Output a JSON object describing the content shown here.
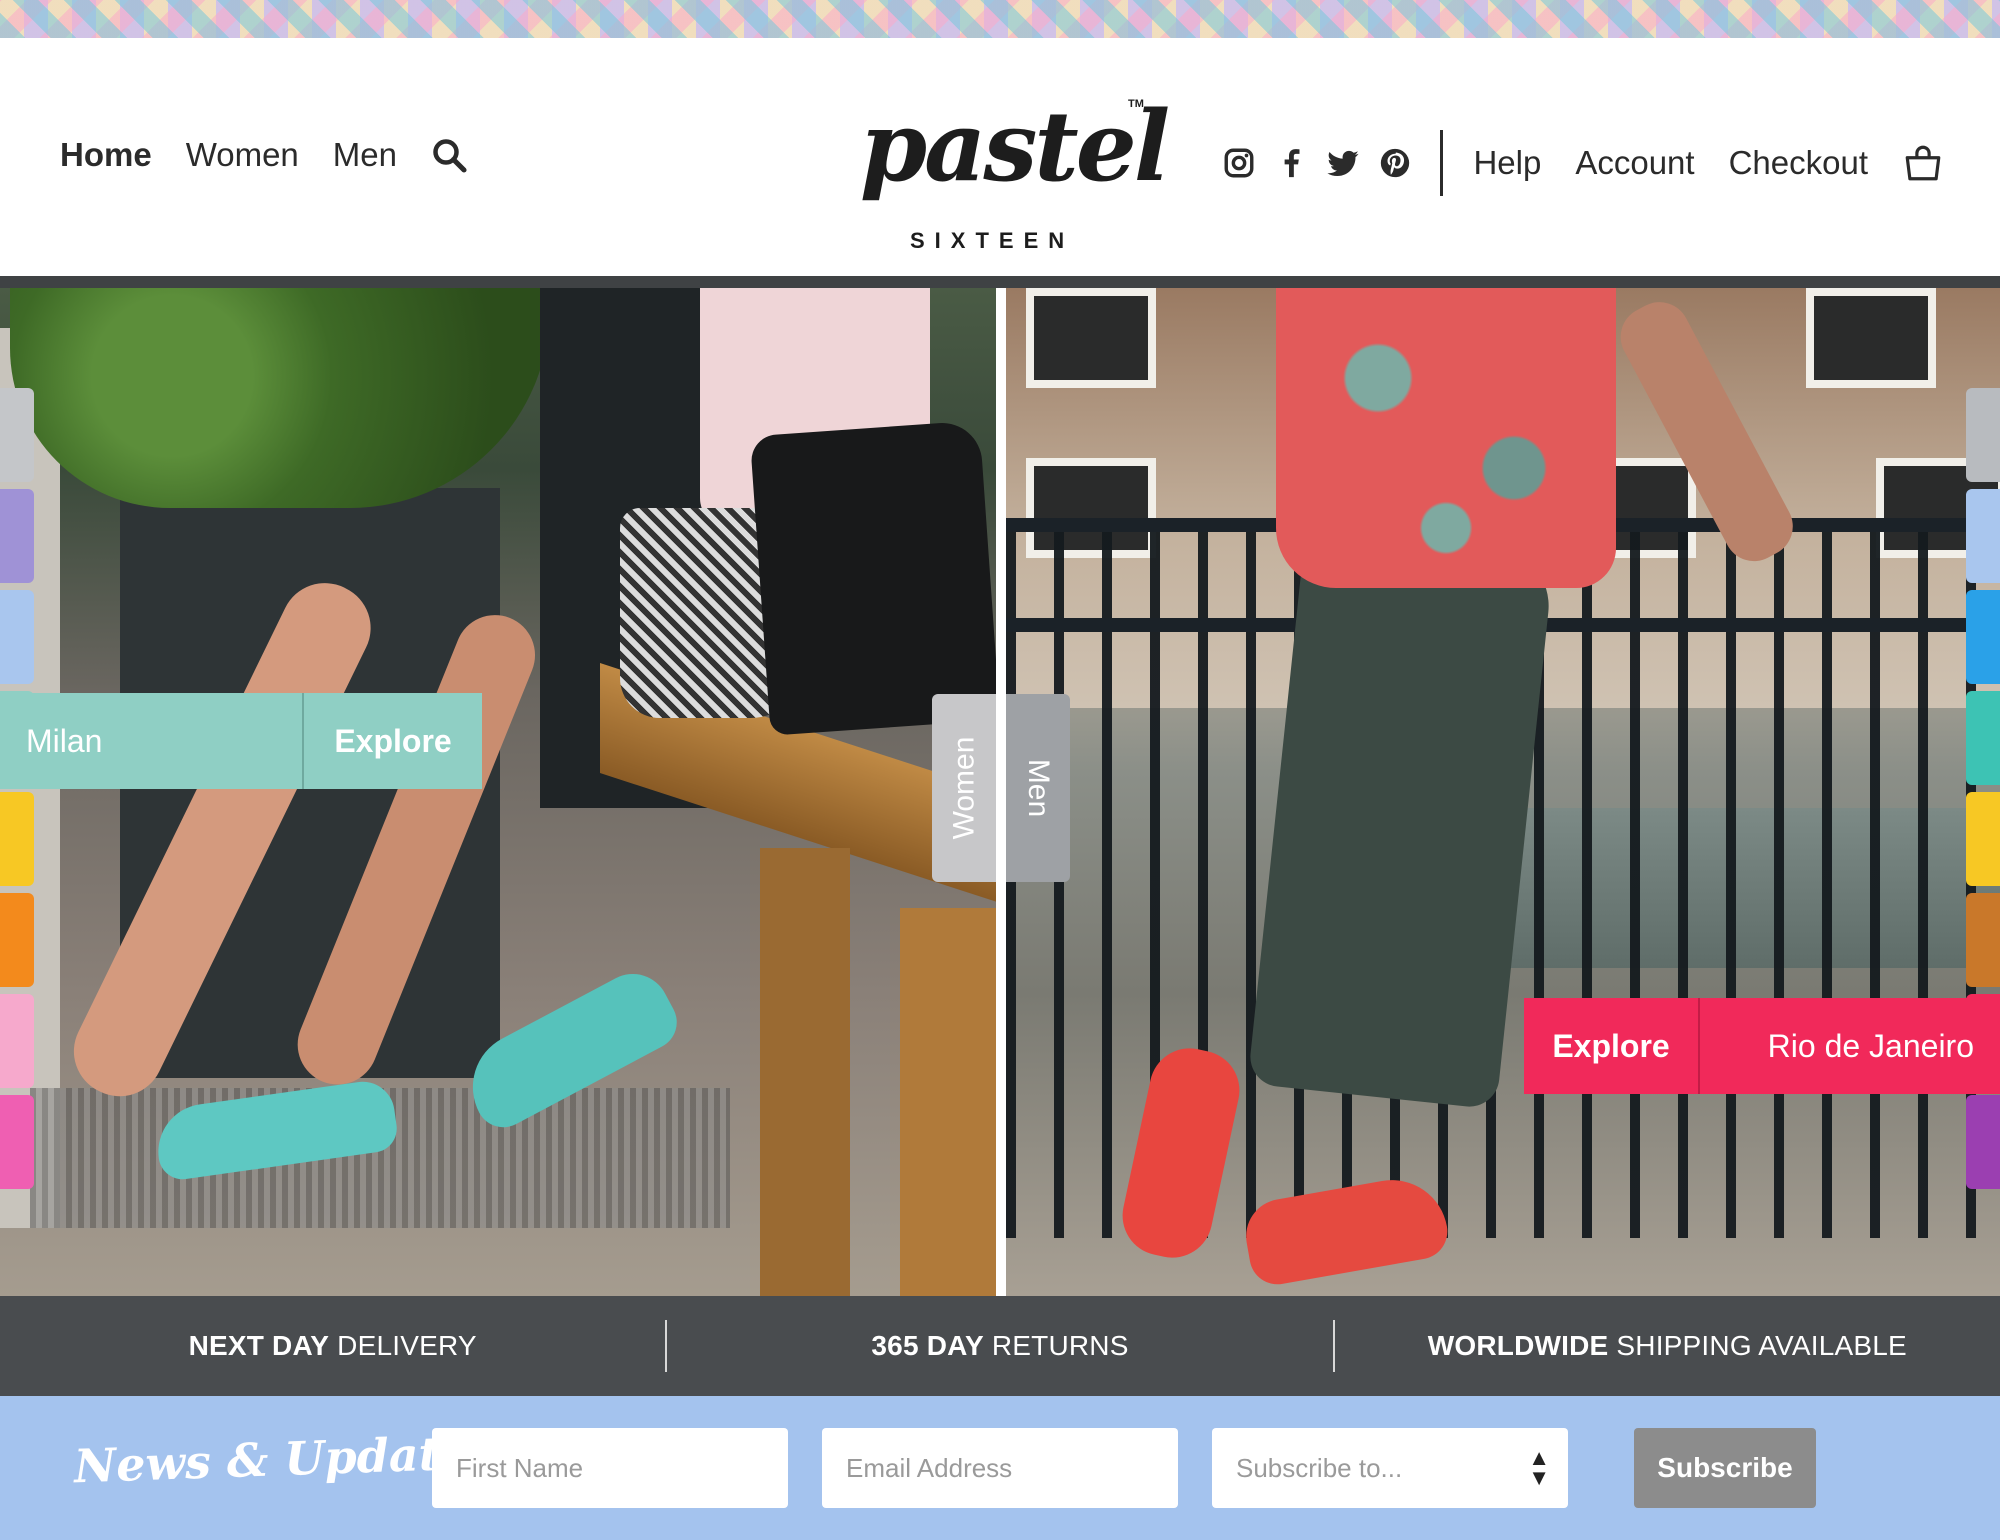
{
  "header": {
    "nav_left": [
      {
        "label": "Home",
        "active": true
      },
      {
        "label": "Women",
        "active": false
      },
      {
        "label": "Men",
        "active": false
      }
    ],
    "logo": {
      "script": "pastel",
      "sub": "SIXTEEN",
      "tm": "TM"
    },
    "social_icons": [
      "instagram-icon",
      "facebook-icon",
      "twitter-icon",
      "pinterest-icon"
    ],
    "nav_right": [
      "Help",
      "Account",
      "Checkout"
    ],
    "cart_icon": "shopping-bag-icon"
  },
  "hero": {
    "left": {
      "city": "Milan",
      "explore": "Explore",
      "accent": "#8fcfc4"
    },
    "right": {
      "city": "Rio de Janeiro",
      "explore": "Explore",
      "accent": "#f1295a"
    },
    "toggle_women": "Women",
    "toggle_men": "Men",
    "left_tab_colors": [
      "#c4c6c9",
      "#9f92d6",
      "#a9c6ee",
      "#8fcfc4",
      "#f7c824",
      "#f38a1c",
      "#f6a9cc",
      "#ef5fb2"
    ],
    "right_tab_colors": [
      "#b8bbbf",
      "#a9c6ee",
      "#2aa1e8",
      "#3dc3b4",
      "#f7c824",
      "#c9782a",
      "#f1295a",
      "#9b3fb1"
    ]
  },
  "benefits": [
    {
      "bold": "NEXT DAY",
      "rest": " DELIVERY"
    },
    {
      "bold": "365 DAY",
      "rest": " RETURNS"
    },
    {
      "bold": "WORLDWIDE",
      "rest": " SHIPPING AVAILABLE"
    }
  ],
  "newsletter": {
    "title": "News & Updates",
    "first_name_placeholder": "First Name",
    "email_placeholder": "Email Address",
    "subscribe_select": "Subscribe to...",
    "subscribe_button": "Subscribe"
  }
}
